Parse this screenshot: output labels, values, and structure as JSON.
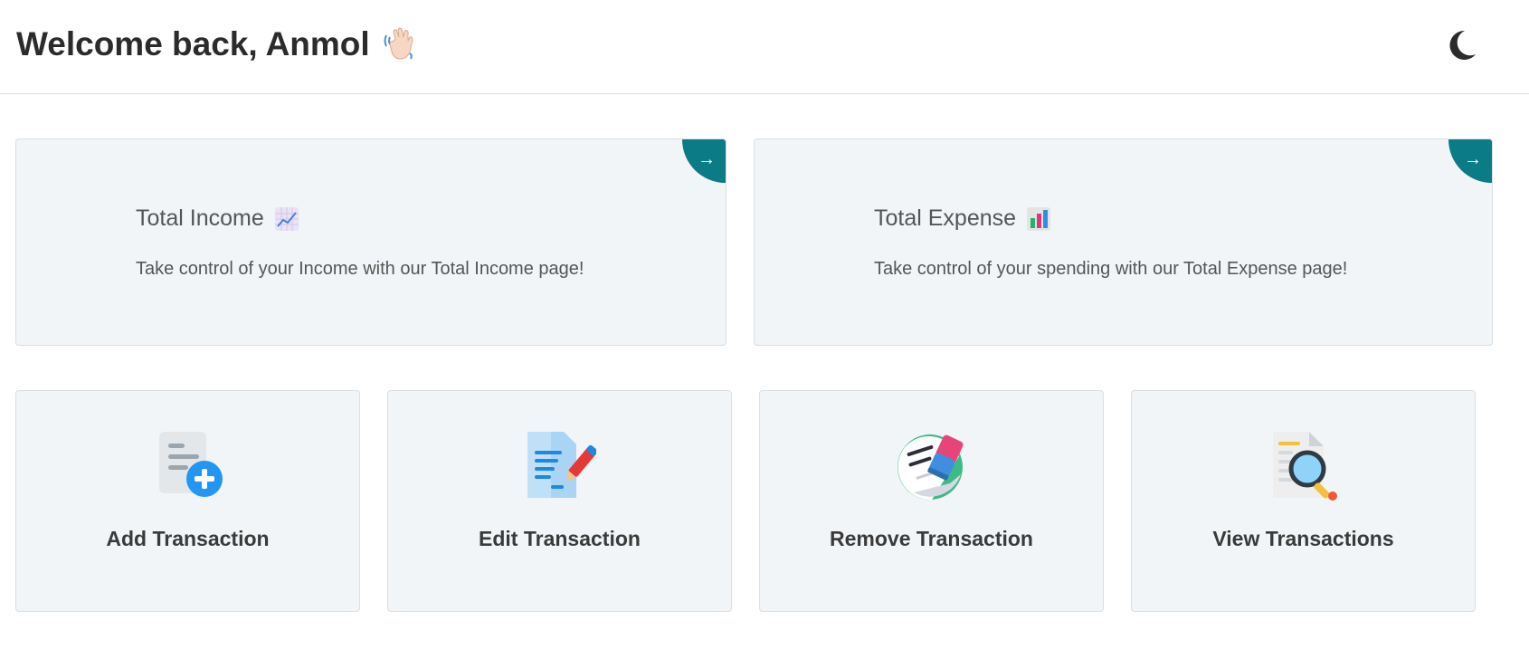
{
  "header": {
    "greeting": "Welcome back, Anmol",
    "greeting_icon": "waving-hand-icon",
    "theme_toggle_icon": "moon-icon"
  },
  "cards": {
    "income": {
      "title": "Total Income",
      "title_icon": "chart-increasing-icon",
      "description": "Take control of your Income with our Total Income page!",
      "arrow": "→"
    },
    "expense": {
      "title": "Total Expense",
      "title_icon": "bar-chart-icon",
      "description": "Take control of your spending with our Total Expense page!",
      "arrow": "→"
    }
  },
  "actions": [
    {
      "label": "Add Transaction",
      "icon": "add-document-icon"
    },
    {
      "label": "Edit Transaction",
      "icon": "edit-document-icon"
    },
    {
      "label": "Remove Transaction",
      "icon": "eraser-icon"
    },
    {
      "label": "View Transactions",
      "icon": "search-document-icon"
    }
  ],
  "colors": {
    "accent": "#0b7b86",
    "card_background": "#f1f5f7"
  }
}
